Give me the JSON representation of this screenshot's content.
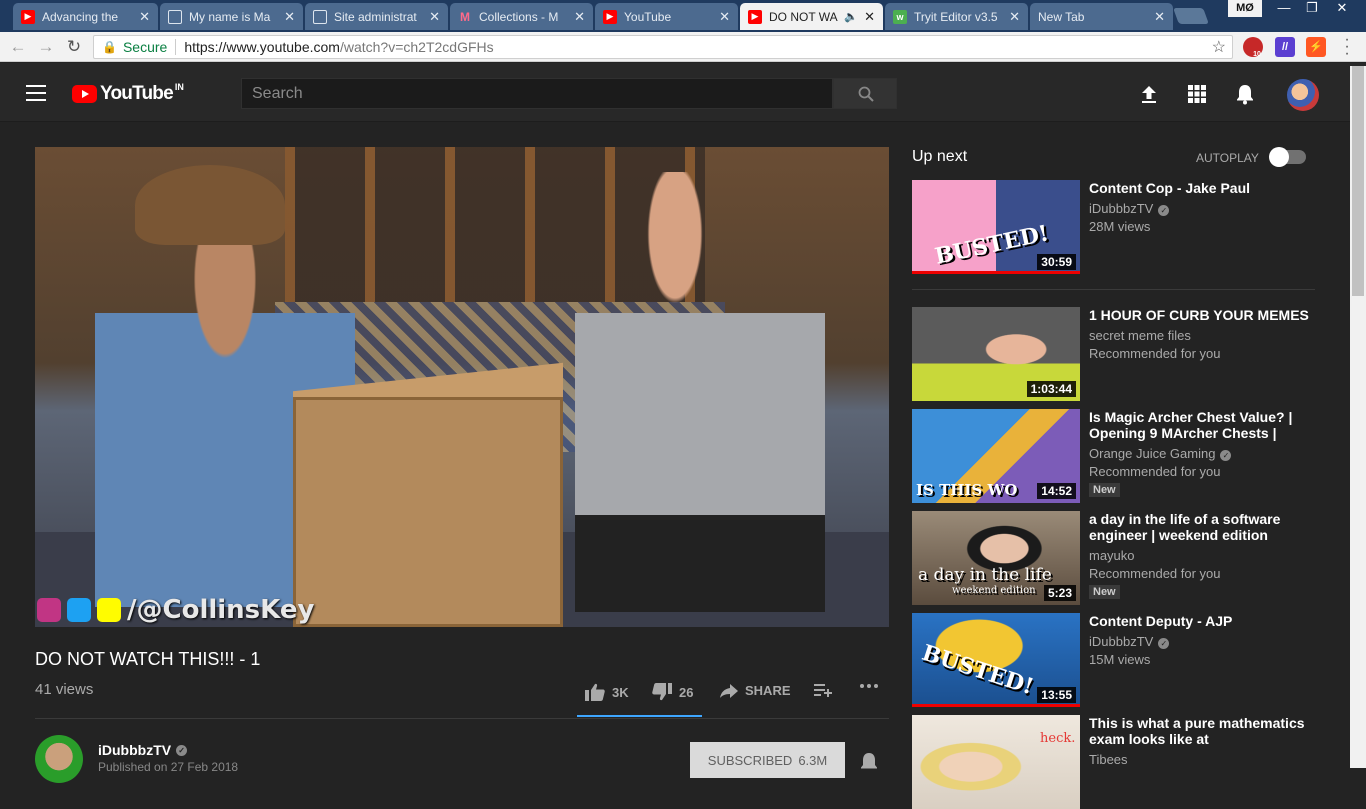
{
  "browser": {
    "tabs": [
      {
        "title": "Advancing the",
        "favicon": "youtube-icon"
      },
      {
        "title": "My name is Ma",
        "favicon": "document-icon"
      },
      {
        "title": "Site administrat",
        "favicon": "document-icon"
      },
      {
        "title": "Collections - M",
        "favicon": "collections-icon"
      },
      {
        "title": "YouTube",
        "favicon": "youtube-icon"
      },
      {
        "title": "DO NOT WA",
        "favicon": "youtube-icon",
        "active": true,
        "audio": true
      },
      {
        "title": "Tryit Editor v3.5",
        "favicon": "tryit-icon"
      },
      {
        "title": "New Tab",
        "favicon": "none"
      }
    ],
    "profile_label": "MØ",
    "secure_label": "Secure",
    "url_host": "https://www.youtube.com",
    "url_path": "/watch?v=ch2T2cdGFHs",
    "ext_badge": "10"
  },
  "header": {
    "logo_text": "YouTube",
    "logo_country": "IN",
    "search_placeholder": "Search"
  },
  "video": {
    "watermark": "/@CollinsKey",
    "title": "DO NOT WATCH THIS!!! - 1",
    "views": "41 views",
    "likes": "3K",
    "dislikes": "26",
    "share_label": "SHARE",
    "channel": "iDubbbzTV",
    "published": "Published on 27 Feb 2018",
    "subscribe_label": "SUBSCRIBED",
    "subscribers": "6.3M"
  },
  "sidebar": {
    "upnext_label": "Up next",
    "autoplay_label": "AUTOPLAY",
    "autoplay_on": false,
    "cards": [
      {
        "title": "Content Cop - Jake Paul",
        "channel": "iDubbbzTV",
        "meta": "28M views",
        "duration": "30:59",
        "verified": true,
        "thumb_text": "BUSTED!"
      },
      {
        "title": "1 HOUR OF CURB YOUR MEMES",
        "channel": "secret meme files",
        "meta": "Recommended for you",
        "duration": "1:03:44",
        "verified": false
      },
      {
        "title": "Is Magic Archer Chest Value? | Opening 9 MArcher Chests |",
        "channel": "Orange Juice Gaming",
        "meta": "Recommended for you",
        "duration": "14:52",
        "verified": true,
        "badge": "New",
        "thumb_text": "IS THIS WO"
      },
      {
        "title": "a day in the life of a software engineer | weekend edition",
        "channel": "mayuko",
        "meta": "Recommended for you",
        "duration": "5:23",
        "verified": false,
        "badge": "New",
        "thumb_text": "a day in the life",
        "thumb_sub": "weekend edition"
      },
      {
        "title": "Content Deputy - AJP",
        "channel": "iDubbbzTV",
        "meta": "15M views",
        "duration": "13:55",
        "verified": true,
        "thumb_text": "BUSTED!"
      },
      {
        "title": "This is what a pure mathematics exam looks like at",
        "channel": "Tibees",
        "meta": "",
        "duration": "",
        "verified": false,
        "thumb_text": "heck."
      }
    ]
  },
  "colors": {
    "youtube_red": "#ff0000",
    "accent_blue": "#3ea6ff",
    "page_bg": "#232323"
  }
}
